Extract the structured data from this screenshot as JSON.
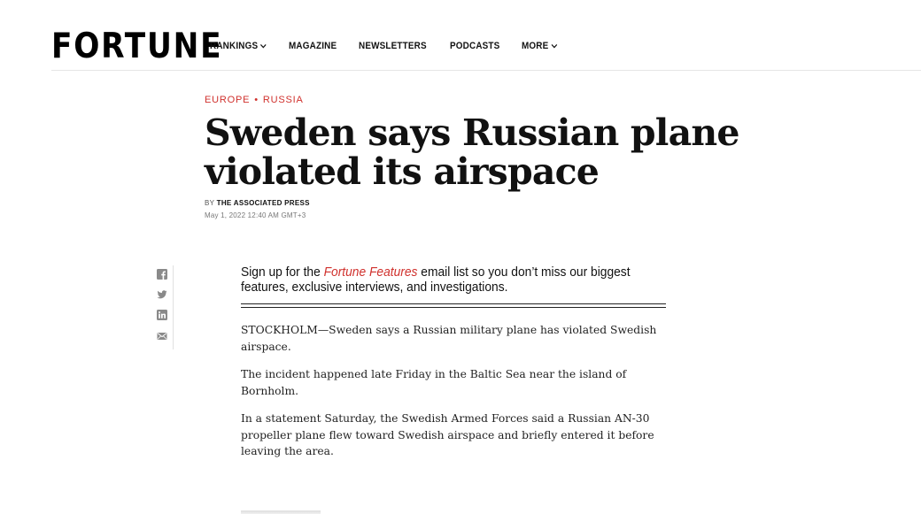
{
  "site": {
    "logo": "FORTUNE",
    "nav": [
      {
        "label": "RANKINGS",
        "has_dropdown": true
      },
      {
        "label": "MAGAZINE",
        "has_dropdown": false
      },
      {
        "label": "NEWSLETTERS",
        "has_dropdown": false
      },
      {
        "label": "PODCASTS",
        "has_dropdown": false
      },
      {
        "label": "MORE",
        "has_dropdown": true
      }
    ]
  },
  "article": {
    "kicker": {
      "section": "EUROPE",
      "separator": "•",
      "topic": "RUSSIA"
    },
    "headline": "Sweden says Russian plane violated its airspace",
    "byline_prefix": "BY",
    "author": "THE ASSOCIATED PRESS",
    "date": "May 1, 2022 12:40 AM GMT+3",
    "promo": {
      "before": "Sign up for the ",
      "link": "Fortune Features",
      "after": " email list so you don’t miss our biggest features, exclusive interviews, and investigations."
    },
    "paragraphs": [
      "STOCKHOLM—Sweden says a Russian military plane has violated Swedish airspace.",
      "The incident happened late Friday in the Baltic Sea near the island of Bornholm.",
      "In a statement Saturday, the Swedish Armed Forces said a Russian AN-30 propeller plane flew toward Swedish airspace and briefly entered it before leaving the area."
    ]
  },
  "social_icons": [
    "facebook-icon",
    "twitter-icon",
    "linkedin-icon",
    "email-icon"
  ],
  "colors": {
    "accent": "#d0312d",
    "text": "#111111",
    "muted": "#777777",
    "icon": "#8a8a8a"
  }
}
